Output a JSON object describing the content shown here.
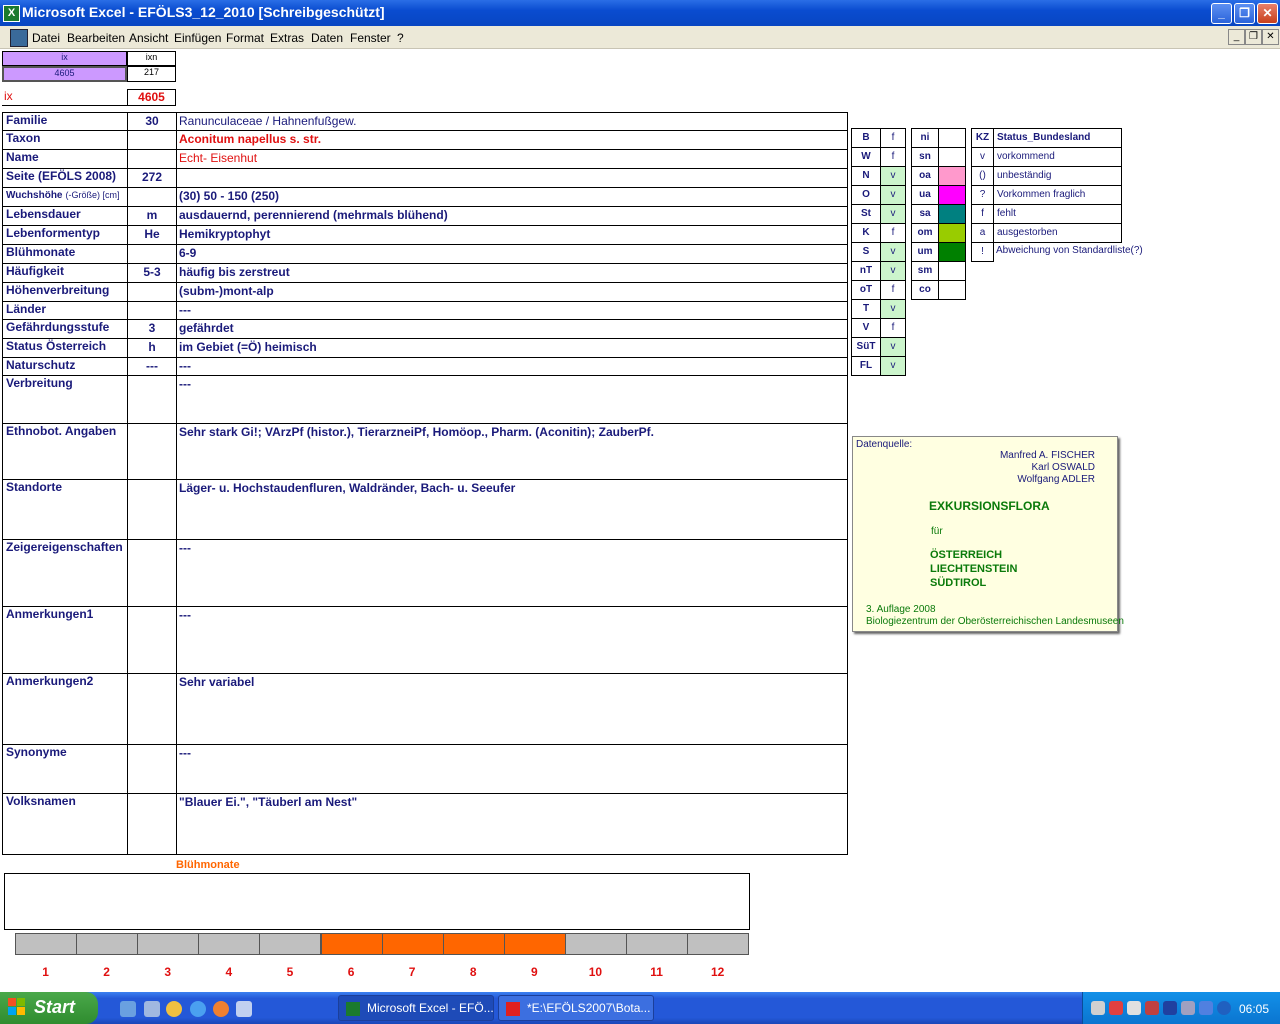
{
  "window": {
    "title": "Microsoft Excel - EFÖLS3_12_2010  [Schreibgeschützt]",
    "app_icon": "X"
  },
  "menu": [
    "Datei",
    "Bearbeiten",
    "Ansicht",
    "Einfügen",
    "Format",
    "Extras",
    "Daten",
    "Fenster",
    "?"
  ],
  "index_box": {
    "ix_label": "ix",
    "ixn_label": "ixn",
    "ix_value": "4605",
    "ixn_value": "217",
    "ix_label2": "ix",
    "ix_value2": "4605"
  },
  "rows": [
    {
      "label": "Familie",
      "code": "30",
      "text": "Ranunculaceae  /  Hahnenfußgew."
    },
    {
      "label": "Taxon",
      "code": "",
      "text": "Aconitum napellus s. str."
    },
    {
      "label": "Name",
      "code": "",
      "text": "Echt- Eisenhut"
    },
    {
      "label": "Seite (EFÖLS 2008)",
      "code": "272",
      "text": ""
    },
    {
      "label": "Wuchshöhe",
      "label_small": "(-Größe) [cm]",
      "code": "",
      "text": "(30) 50 - 150 (250)"
    },
    {
      "label": "Lebensdauer",
      "code": "m",
      "text": "ausdauernd, perennierend (mehrmals blühend)"
    },
    {
      "label": "Lebenformentyp",
      "code": "He",
      "text": "Hemikryptophyt"
    },
    {
      "label": "Blühmonate",
      "code": "",
      "text": "6-9"
    },
    {
      "label": "Häufigkeit",
      "code": "5-3",
      "text": "häufig bis zerstreut"
    },
    {
      "label": "Höhenverbreitung",
      "code": "",
      "text": "(subm-)mont-alp"
    },
    {
      "label": "Länder",
      "code": "",
      "text": "---"
    },
    {
      "label": "Gefährdungsstufe",
      "code": "3",
      "text": "gefährdet"
    },
    {
      "label": "Status Österreich",
      "code": "h",
      "text": "im Gebiet (=Ö) heimisch"
    },
    {
      "label": "Naturschutz",
      "code": "---",
      "text": "---"
    },
    {
      "label": "Verbreitung",
      "code": "",
      "text": "---"
    },
    {
      "label": "Ethnobot. Angaben",
      "code": "",
      "text": "Sehr stark Gi!; VArzPf (histor.), TierarzneiPf, Homöop., Pharm. (Aconitin); ZauberPf."
    },
    {
      "label": "Standorte",
      "code": "",
      "text": "Läger- u. Hochstaudenfluren, Waldränder, Bach- u. Seeufer"
    },
    {
      "label": "Zeigereigenschaften",
      "code": "",
      "text": "---"
    },
    {
      "label": "Anmerkungen1",
      "code": "",
      "text": "---"
    },
    {
      "label": "Anmerkungen2",
      "code": "",
      "text": "Sehr variabel"
    },
    {
      "label": "Synonyme",
      "code": "",
      "text": "---"
    },
    {
      "label": "Volksnamen",
      "code": "",
      "text": " \"Blauer Ei.\", \"Täuberl am Nest\""
    }
  ],
  "regions": [
    {
      "k": "B",
      "v": "f"
    },
    {
      "k": "W",
      "v": "f"
    },
    {
      "k": "N",
      "v": "v"
    },
    {
      "k": "O",
      "v": "v"
    },
    {
      "k": "St",
      "v": "v"
    },
    {
      "k": "K",
      "v": "f"
    },
    {
      "k": "S",
      "v": "v"
    },
    {
      "k": "nT",
      "v": "v"
    },
    {
      "k": "oT",
      "v": "f"
    },
    {
      "k": "T",
      "v": "v"
    },
    {
      "k": "V",
      "v": "f"
    },
    {
      "k": "SüT",
      "v": "v"
    },
    {
      "k": "FL",
      "v": "v"
    }
  ],
  "alt_legend": [
    {
      "k": "ni",
      "color": "#ffffff"
    },
    {
      "k": "sn",
      "color": "#ffffff"
    },
    {
      "k": "oa",
      "color": "#ff99cc"
    },
    {
      "k": "ua",
      "color": "#ff00ff"
    },
    {
      "k": "sa",
      "color": "#008080"
    },
    {
      "k": "om",
      "color": "#99cc00"
    },
    {
      "k": "um",
      "color": "#008000"
    },
    {
      "k": "sm",
      "color": "#ffffff"
    },
    {
      "k": "co",
      "color": "#ffffff"
    }
  ],
  "status_legend": {
    "kz_header": "KZ",
    "title": "Status_Bundesland",
    "items": [
      {
        "k": "v",
        "t": "vorkommend"
      },
      {
        "k": "()",
        "t": "unbeständig"
      },
      {
        "k": "?",
        "t": "Vorkommen fraglich"
      },
      {
        "k": "f",
        "t": "fehlt"
      },
      {
        "k": "a",
        "t": "ausgestorben"
      },
      {
        "k": "!",
        "t": "Abweichung von Standardliste(?)"
      }
    ]
  },
  "datenquelle": {
    "label": "Datenquelle:",
    "authors": [
      "Manfred A. FISCHER",
      "Karl OSWALD",
      "Wolfgang ADLER"
    ],
    "title": "EXKURSIONSFLORA",
    "fuer": "für",
    "countries": [
      "ÖSTERREICH",
      "LIECHTENSTEIN",
      "SÜDTIROL"
    ],
    "edition": "3. Auflage 2008",
    "publisher": "Biologiezentrum der Oberösterreichischen Landesmuseen"
  },
  "bluhmonate": {
    "title": "Blühmonate",
    "months": [
      "1",
      "2",
      "3",
      "4",
      "5",
      "6",
      "7",
      "8",
      "9",
      "10",
      "11",
      "12"
    ],
    "active": [
      6,
      7,
      8,
      9
    ],
    "active_color": "#ff6600",
    "inactive_color": "#c0c0c0"
  },
  "taskbar": {
    "start": "Start",
    "buttons": [
      "Microsoft Excel - EFÖ...",
      "*E:\\EFÖLS2007\\Bota..."
    ],
    "time": "06:05"
  }
}
